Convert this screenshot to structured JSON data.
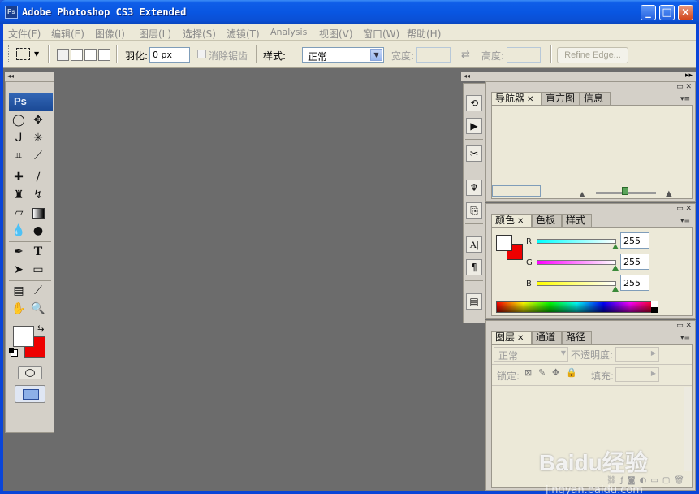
{
  "window": {
    "title": "Adobe Photoshop CS3 Extended",
    "app_icon": "Ps"
  },
  "menubar": {
    "items": [
      "文件(F)",
      "编辑(E)",
      "图像(I)",
      "图层(L)",
      "选择(S)",
      "滤镜(T)",
      "Analysis",
      "视图(V)",
      "窗口(W)",
      "帮助(H)"
    ]
  },
  "options": {
    "feather_label": "羽化:",
    "feather_value": "0 px",
    "antialias_label": "消除锯齿",
    "style_label": "样式:",
    "style_value": "正常",
    "width_label": "宽度:",
    "height_label": "高度:",
    "refine_edge": "Refine Edge..."
  },
  "tools": {
    "logo": "Ps"
  },
  "navigator_panel": {
    "tabs": [
      "导航器",
      "直方图",
      "信息"
    ]
  },
  "color_panel": {
    "tabs": [
      "颜色",
      "色板",
      "样式"
    ],
    "channels": [
      {
        "label": "R",
        "value": "255"
      },
      {
        "label": "G",
        "value": "255"
      },
      {
        "label": "B",
        "value": "255"
      }
    ]
  },
  "layers_panel": {
    "tabs": [
      "图层",
      "通道",
      "路径"
    ],
    "blend_mode": "正常",
    "opacity_label": "不透明度:",
    "lock_label": "锁定:",
    "fill_label": "填充:"
  },
  "watermark": {
    "brand": "Baidu经验",
    "url": "jingyan.baidu.com"
  },
  "colors": {
    "foreground": "#ffffff",
    "background": "#ee0000",
    "workspace": "#6c6c6c",
    "titlebar": "#0a56e2"
  }
}
